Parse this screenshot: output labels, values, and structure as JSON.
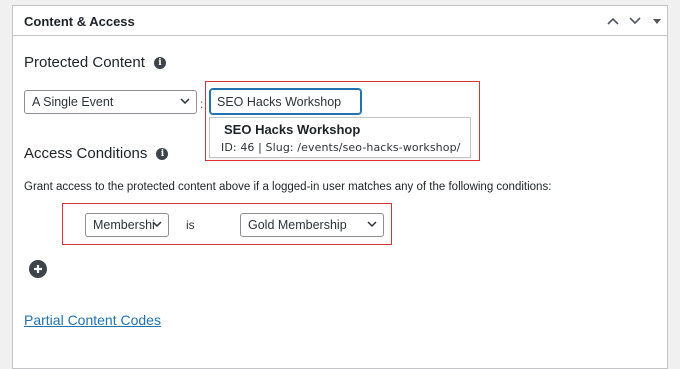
{
  "panel": {
    "title": "Content & Access",
    "header_buttons": [
      "chevron-up-icon",
      "chevron-down-icon",
      "triangle-down-icon"
    ]
  },
  "protected_content": {
    "heading": "Protected Content",
    "type_select": "A Single Event",
    "search_value": "SEO Hacks Workshop",
    "suggestion": {
      "title": "SEO Hacks Workshop",
      "meta": "ID: 46 | Slug: /events/seo-hacks-workshop/"
    }
  },
  "access_conditions": {
    "heading": "Access Conditions",
    "description": "Grant access to the protected content above if a logged-in user matches any of the following conditions:",
    "condition": {
      "field": "Membership",
      "operator": "is",
      "value": "Gold Membership"
    }
  },
  "partial_content_link": "Partial Content Codes",
  "colors": {
    "accent": "#2271b1",
    "highlight": "#d63638",
    "border": "#c3c4c7"
  }
}
